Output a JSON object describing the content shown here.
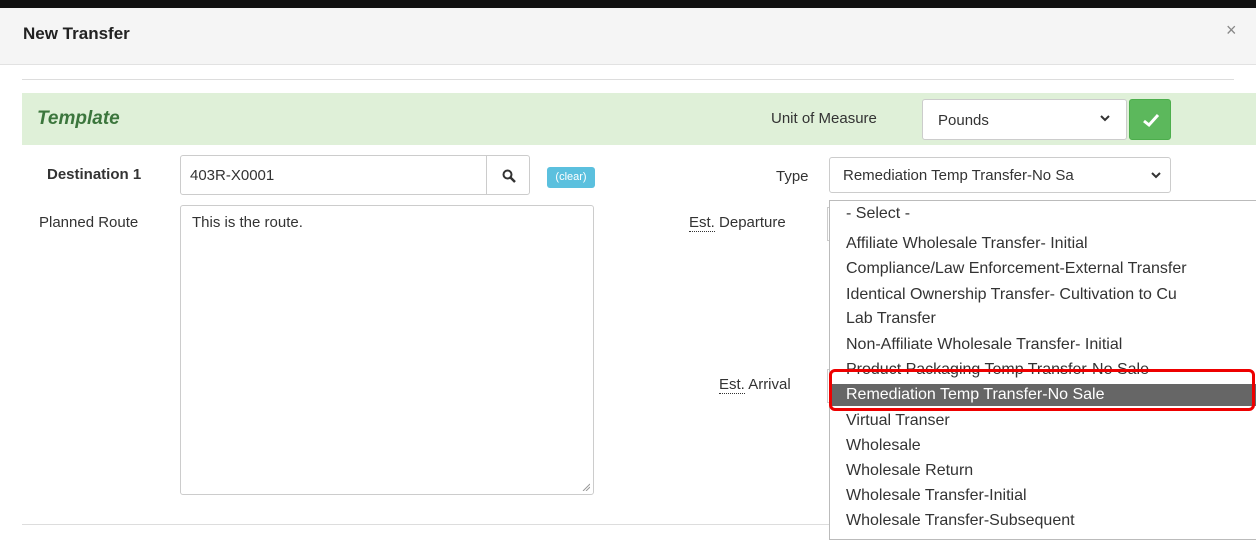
{
  "dialog": {
    "title": "New Transfer",
    "close_glyph": "×"
  },
  "template": {
    "title": "Template",
    "unit_of_measure_label": "Unit of Measure",
    "unit_of_measure_value": "Pounds"
  },
  "form": {
    "destination_label": "Destination 1",
    "destination_value": "403R-X0001",
    "clear_label": "(clear)",
    "type_label": "Type",
    "type_value": "Remediation Temp Transfer-No Sa",
    "planned_route_label": "Planned Route",
    "planned_route_value": "This is the route.",
    "est_prefix": "Est.",
    "departure_label": "Departure",
    "arrival_label": "Arrival"
  },
  "type_options": [
    "- Select -",
    "Affiliate Wholesale Transfer- Initial",
    "Compliance/Law Enforcement-External Transfer",
    "Identical Ownership Transfer- Cultivation to Cu",
    "Lab Transfer",
    "Non-Affiliate Wholesale Transfer- Initial",
    "Product Packaging Temp Transfer-No Sale",
    "Remediation Temp Transfer-No Sale",
    "Virtual Transer",
    "Wholesale",
    "Wholesale Return",
    "Wholesale Transfer-Initial",
    "Wholesale Transfer-Subsequent"
  ],
  "selected_option": "Remediation Temp Transfer-No Sale",
  "colors": {
    "template_bg": "#dff0d8",
    "template_title": "#3c763d",
    "confirm_button": "#5cb85c",
    "clear_button": "#5bc0de",
    "highlight_outline": "#ee0000",
    "selected_option_bg": "#666666"
  },
  "icons": [
    "close-icon",
    "chevron-down-icon",
    "checkmark-icon",
    "search-icon",
    "resize-grip-icon"
  ]
}
